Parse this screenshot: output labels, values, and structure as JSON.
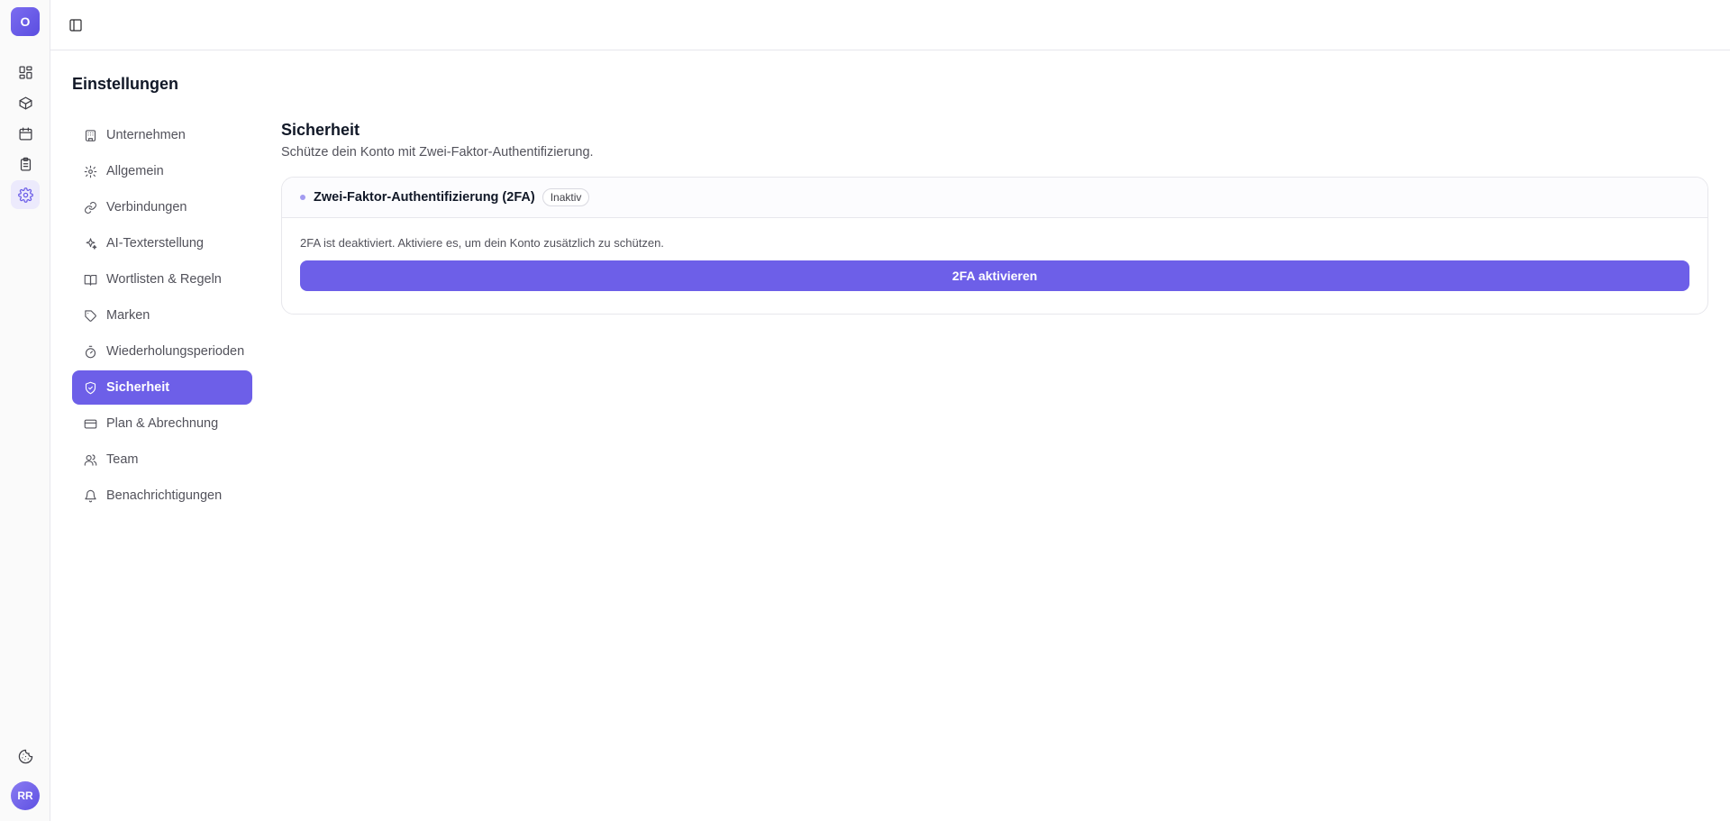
{
  "app": {
    "logo_letter": "O",
    "user_initials": "RR"
  },
  "rail": {
    "items": [
      {
        "icon": "dashboard-icon",
        "active": false
      },
      {
        "icon": "box-icon",
        "active": false
      },
      {
        "icon": "calendar-icon",
        "active": false
      },
      {
        "icon": "clipboard-icon",
        "active": false
      },
      {
        "icon": "gear-icon",
        "active": true
      }
    ],
    "bottom": {
      "icon": "cookie-icon"
    }
  },
  "page": {
    "title": "Einstellungen"
  },
  "subnav": {
    "items": [
      {
        "label": "Unternehmen",
        "icon": "building-icon"
      },
      {
        "label": "Allgemein",
        "icon": "gear-icon"
      },
      {
        "label": "Verbindungen",
        "icon": "link-icon"
      },
      {
        "label": "AI-Texterstellung",
        "icon": "sparkles-icon"
      },
      {
        "label": "Wortlisten & Regeln",
        "icon": "book-icon"
      },
      {
        "label": "Marken",
        "icon": "tag-icon"
      },
      {
        "label": "Wiederholungsperioden",
        "icon": "timer-icon"
      },
      {
        "label": "Sicherheit",
        "icon": "shield-check-icon",
        "active": true
      },
      {
        "label": "Plan & Abrechnung",
        "icon": "credit-card-icon"
      },
      {
        "label": "Team",
        "icon": "users-icon"
      },
      {
        "label": "Benachrichtigungen",
        "icon": "bell-icon"
      }
    ]
  },
  "section": {
    "title": "Sicherheit",
    "description": "Schütze dein Konto mit Zwei-Faktor-Authentifizierung."
  },
  "twofa": {
    "title": "Zwei-Faktor-Authentifizierung (2FA)",
    "status": "Inaktiv",
    "message": "2FA ist deaktiviert. Aktiviere es, um dein Konto zusätzlich zu schützen.",
    "button": "2FA aktivieren"
  },
  "colors": {
    "accent": "#6d5fe8",
    "border": "#e7e7ec"
  }
}
